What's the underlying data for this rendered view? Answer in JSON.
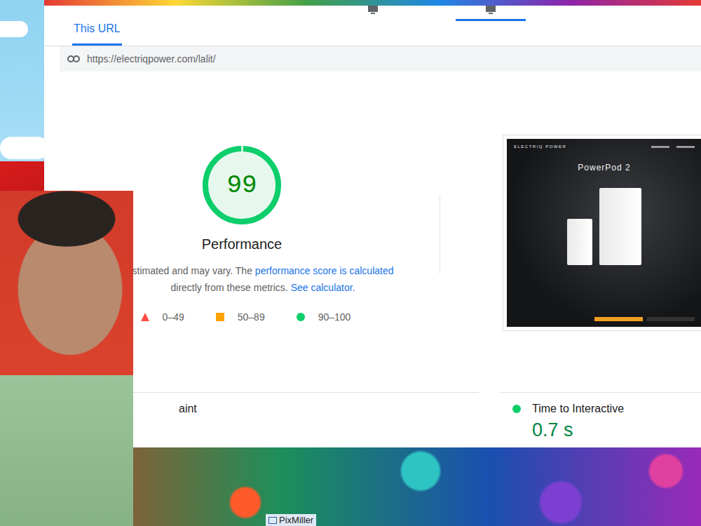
{
  "device_tabs": [
    {
      "selected": false
    },
    {
      "selected": true
    }
  ],
  "tabs": [
    {
      "label": "This URL",
      "selected": true
    }
  ],
  "url": "https://electriqpower.com/lalit/",
  "score": {
    "value": "99",
    "label": "Performance",
    "level": 0.99,
    "color": "#0cce6b"
  },
  "description": {
    "text": "stimated and may vary. The ",
    "link": "performance score is calculated",
    "text2": "directly from these metrics. ",
    "link2": "See calculator."
  },
  "legend": [
    {
      "kind": "triangle",
      "label": "0–49",
      "color": "#ff4e42"
    },
    {
      "kind": "square",
      "label": "50–89",
      "color": "#ffa400"
    },
    {
      "kind": "circle",
      "label": "90–100",
      "color": "#0cce6b"
    }
  ],
  "thumbnail": {
    "logo": "ELECTRIQ POWER",
    "heading": "PowerPod 2"
  },
  "metrics": [
    {
      "label": "aint",
      "value": "",
      "color": ""
    },
    {
      "label": "Time to Interactive",
      "value": "0.7 s",
      "color": "#0cce6b"
    }
  ],
  "watermark": "PixMiller"
}
